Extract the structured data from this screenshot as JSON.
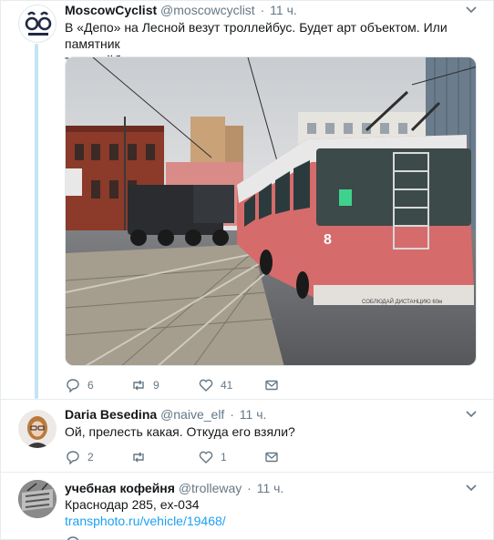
{
  "tweets": [
    {
      "name": "MoscowCyclist",
      "handle": "@moscowcyclist",
      "sep": "·",
      "time": "11 ч.",
      "text_line1": "В «Депо» на Лесной везут троллейбус. Будет арт объектом. Или памятник",
      "text_line2": "троллейбусу",
      "replies": "6",
      "retweets": "9",
      "likes": "41",
      "trolley_number": "8",
      "trolley_plate": "СОБЛЮДАЙ ДИСТАНЦИЮ 60м"
    },
    {
      "name": "Daria Besedina",
      "handle": "@naive_elf",
      "sep": "·",
      "time": "11 ч.",
      "text_line1": "Ой, прелесть какая. Откуда его взяли?",
      "replies": "2",
      "retweets": "",
      "likes": "1"
    },
    {
      "name": "учебная кофейня",
      "handle": "@trolleway",
      "sep": "·",
      "time": "11 ч.",
      "text_line1": "Краснодар 285, ex-034",
      "link": "transphoto.ru/vehicle/19468/"
    }
  ],
  "colors": {
    "thread": "#c4e4f6",
    "link": "#1da1f2",
    "muted": "#657786"
  }
}
